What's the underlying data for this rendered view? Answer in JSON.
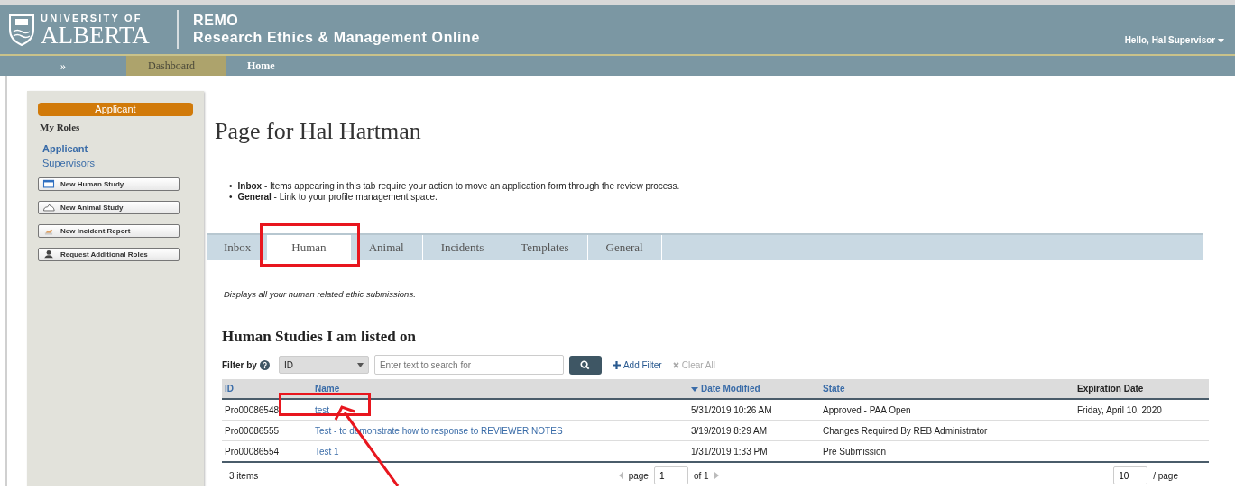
{
  "header": {
    "logo_top": "UNIVERSITY OF",
    "logo_bottom": "ALBERTA",
    "app_name": "REMO",
    "app_subtitle": "Research Ethics & Management Online",
    "user_menu": "Hello, Hal Supervisor"
  },
  "nav": {
    "toggle": "»",
    "items": [
      {
        "label": "Dashboard",
        "selected": true
      },
      {
        "label": "Home",
        "selected": false
      }
    ]
  },
  "sidebar": {
    "role_badge": "Applicant",
    "heading": "My Roles",
    "roles": [
      {
        "label": "Applicant",
        "selected": true
      },
      {
        "label": "Supervisors",
        "selected": false
      }
    ],
    "buttons": [
      {
        "label": "New Human Study"
      },
      {
        "label": "New Animal Study"
      },
      {
        "label": "New Incident Report"
      },
      {
        "label": "Request Additional Roles"
      }
    ]
  },
  "page": {
    "title": "Page for Hal Hartman",
    "bullets": [
      {
        "marker": "•",
        "text": "**Inbox**  - Items appearing in this tab require your action to move an application form through the review process."
      },
      {
        "marker": "•",
        "text": "**General** - Link to your profile management space."
      }
    ]
  },
  "tabs": [
    {
      "label": "Inbox",
      "selected": false
    },
    {
      "label": "Human",
      "selected": true
    },
    {
      "label": "Animal",
      "selected": false
    },
    {
      "label": "Incidents",
      "selected": false
    },
    {
      "label": "Templates",
      "selected": false
    },
    {
      "label": "General",
      "selected": false
    }
  ],
  "tab_description": "Displays all your human related ethic submissions.",
  "section_title": "Human Studies I am listed on",
  "filter": {
    "label": "Filter by",
    "field": "ID",
    "search_placeholder": "Enter text to search for",
    "add_filter": "Add Filter",
    "clear_all": "Clear All"
  },
  "table": {
    "columns": [
      {
        "label": "ID",
        "sortable": true,
        "sorted": false
      },
      {
        "label": "Name",
        "sortable": true,
        "sorted": false
      },
      {
        "label": "Date Modified",
        "sortable": true,
        "sorted": true
      },
      {
        "label": "State",
        "sortable": true,
        "sorted": false
      },
      {
        "label": "Expiration Date",
        "sortable": false,
        "sorted": false
      }
    ],
    "rows": [
      [
        "Pro00086548",
        "test",
        "5/31/2019 10:26 AM",
        "Approved - PAA Open",
        "Friday, April 10, 2020"
      ],
      [
        "Pro00086555",
        "Test - to demonstrate how to response to REVIEWER NOTES",
        "3/19/2019 8:29 AM",
        "Changes Required By REB Administrator",
        ""
      ],
      [
        "Pro00086554",
        "Test 1",
        "1/31/2019 1:33 PM",
        "Pre Submission",
        ""
      ]
    ]
  },
  "pager": {
    "count": "3 items",
    "page_label": "page",
    "page": "1",
    "of": "of 1",
    "page_size": "10",
    "per_page": "/ page"
  },
  "annotations": [
    {
      "kind": "box"
    },
    {
      "kind": "box"
    },
    {
      "kind": "arrow"
    }
  ]
}
